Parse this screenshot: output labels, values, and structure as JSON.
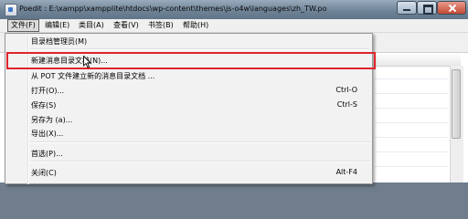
{
  "window": {
    "title": "Poedit : E:\\xampp\\xampplite\\htdocs\\wp-content\\themes\\js-o4w\\languages\\zh_TW.po",
    "accent": "#6e8296"
  },
  "menubar": {
    "items": [
      {
        "label": "文件(F)",
        "active": true
      },
      {
        "label": "编辑(E)"
      },
      {
        "label": "类目(A)"
      },
      {
        "label": "查看(V)"
      },
      {
        "label": "书签(B)"
      },
      {
        "label": "帮助(H)"
      }
    ]
  },
  "file_menu": {
    "items": [
      {
        "label": "目录档管理员(M)",
        "shortcut": ""
      },
      {
        "label": "新建消息目录文档(N)...",
        "shortcut": "",
        "highlighted": true
      },
      {
        "label": "从 POT 文件建立新的消息目录文档 ...",
        "shortcut": ""
      },
      {
        "label": "打开(O)...",
        "shortcut": "Ctrl-O"
      },
      {
        "label": "保存(S)",
        "shortcut": "Ctrl-S"
      },
      {
        "label": "另存为 (a)...",
        "shortcut": ""
      },
      {
        "label": "导出(X)...",
        "shortcut": ""
      },
      {
        "label": "首选(P)...",
        "shortcut": ""
      },
      {
        "label": "关闭(C)",
        "shortcut": "Alt-F4"
      }
    ],
    "highlight_color": "#e0242b"
  }
}
